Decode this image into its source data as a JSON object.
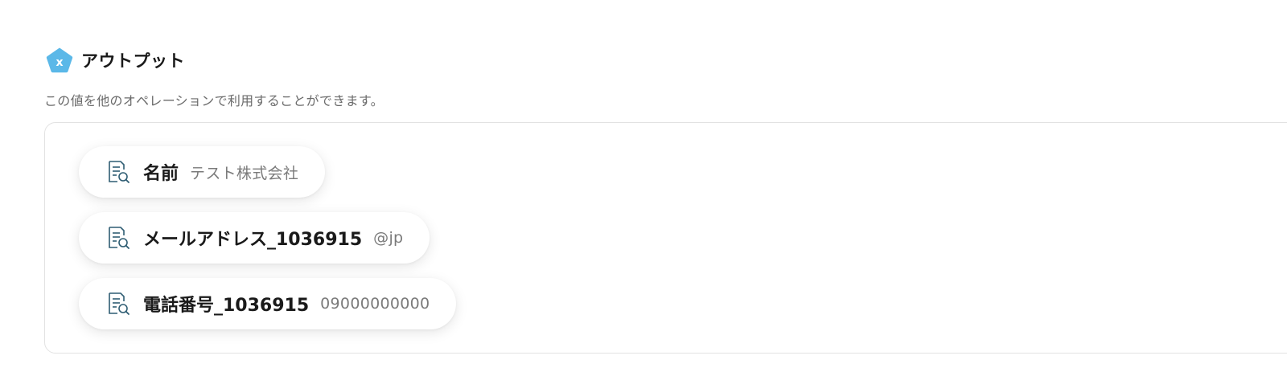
{
  "output": {
    "title": "アウトプット",
    "icon": "variable-x-pentagon-icon",
    "accent_color": "#5bb8e8",
    "description": "この値を他のオペレーションで利用することができます。"
  },
  "items": [
    {
      "label": "名前",
      "value": "テスト株式会社",
      "icon": "document-search-icon"
    },
    {
      "label": "メールアドレス_1036915",
      "value": "@jp",
      "icon": "document-search-icon"
    },
    {
      "label": "電話番号_1036915",
      "value": "09000000000",
      "icon": "document-search-icon"
    }
  ],
  "colors": {
    "icon_stroke": "#2f5d73",
    "value_text": "#7a7a7a"
  }
}
